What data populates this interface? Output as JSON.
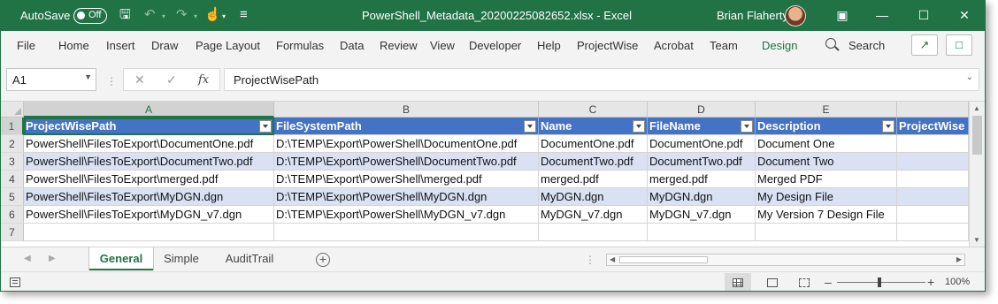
{
  "titlebar": {
    "autosave_label": "AutoSave",
    "autosave_state": "Off",
    "document_title": "PowerShell_Metadata_20200225082652.xlsx  -  Excel",
    "user_name": "Brian Flaherty",
    "icons": [
      "save-icon",
      "undo-icon",
      "redo-icon",
      "touch-mode-icon",
      "customize-qat-icon",
      "ribbon-display-icon",
      "minimize-icon",
      "maximize-icon",
      "close-icon"
    ]
  },
  "ribbon": {
    "tabs": [
      "File",
      "Home",
      "Insert",
      "Draw",
      "Page Layout",
      "Formulas",
      "Data",
      "Review",
      "View",
      "Developer",
      "Help",
      "ProjectWise",
      "Acrobat",
      "Team",
      "Design"
    ],
    "search_label": "Search",
    "accent": "#217346"
  },
  "formula_bar": {
    "name_box": "A1",
    "formula": "ProjectWisePath"
  },
  "grid": {
    "columns": [
      "A",
      "B",
      "C",
      "D",
      "E"
    ],
    "rows": [
      "1",
      "2",
      "3",
      "4",
      "5",
      "6",
      "7"
    ],
    "headers": [
      "ProjectWisePath",
      "FileSystemPath",
      "Name",
      "FileName",
      "Description",
      "ProjectWise"
    ],
    "data": [
      [
        "PowerShell\\FilesToExport\\DocumentOne.pdf",
        "D:\\TEMP\\Export\\PowerShell\\DocumentOne.pdf",
        "DocumentOne.pdf",
        "DocumentOne.pdf",
        "Document One",
        ""
      ],
      [
        "PowerShell\\FilesToExport\\DocumentTwo.pdf",
        "D:\\TEMP\\Export\\PowerShell\\DocumentTwo.pdf",
        "DocumentTwo.pdf",
        "DocumentTwo.pdf",
        "Document Two",
        ""
      ],
      [
        "PowerShell\\FilesToExport\\merged.pdf",
        "D:\\TEMP\\Export\\PowerShell\\merged.pdf",
        "merged.pdf",
        "merged.pdf",
        "Merged PDF",
        ""
      ],
      [
        "PowerShell\\FilesToExport\\MyDGN.dgn",
        "D:\\TEMP\\Export\\PowerShell\\MyDGN.dgn",
        "MyDGN.dgn",
        "MyDGN.dgn",
        "My Design File",
        ""
      ],
      [
        "PowerShell\\FilesToExport\\MyDGN_v7.dgn",
        "D:\\TEMP\\Export\\PowerShell\\MyDGN_v7.dgn",
        "MyDGN_v7.dgn",
        "MyDGN_v7.dgn",
        "My Version 7 Design File",
        ""
      ]
    ],
    "header_color": "#4472c4",
    "band_color": "#d9e1f2"
  },
  "sheets": {
    "tabs": [
      "General",
      "Simple",
      "AuditTrail"
    ],
    "active": "General"
  },
  "statusbar": {
    "zoom": "100%"
  }
}
